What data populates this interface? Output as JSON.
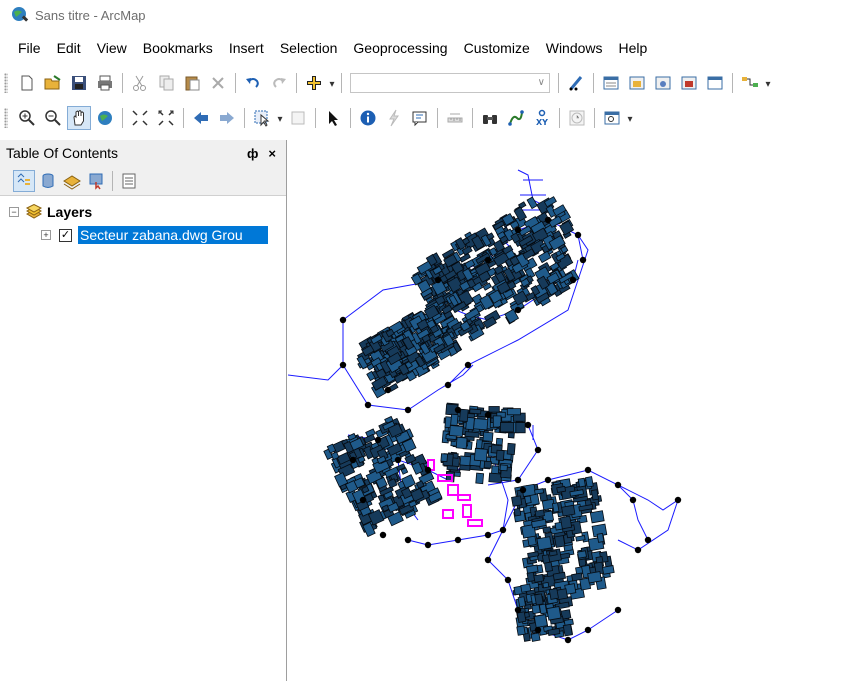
{
  "window": {
    "title": "Sans titre - ArcMap"
  },
  "menu": [
    "File",
    "Edit",
    "View",
    "Bookmarks",
    "Insert",
    "Selection",
    "Geoprocessing",
    "Customize",
    "Windows",
    "Help"
  ],
  "toc": {
    "title": "Table Of Contents",
    "pin_label": "ф",
    "close_label": "×",
    "root_label": "Layers",
    "root_expander": "−",
    "layer": {
      "name": "Secteur zabana.dwg Grou",
      "checked": true,
      "expander": "+"
    }
  },
  "colors": {
    "selection": "#0078d7",
    "buildings": "#1f4f7a",
    "roads": "#1a1aff",
    "highlight": "#ff00ff"
  }
}
